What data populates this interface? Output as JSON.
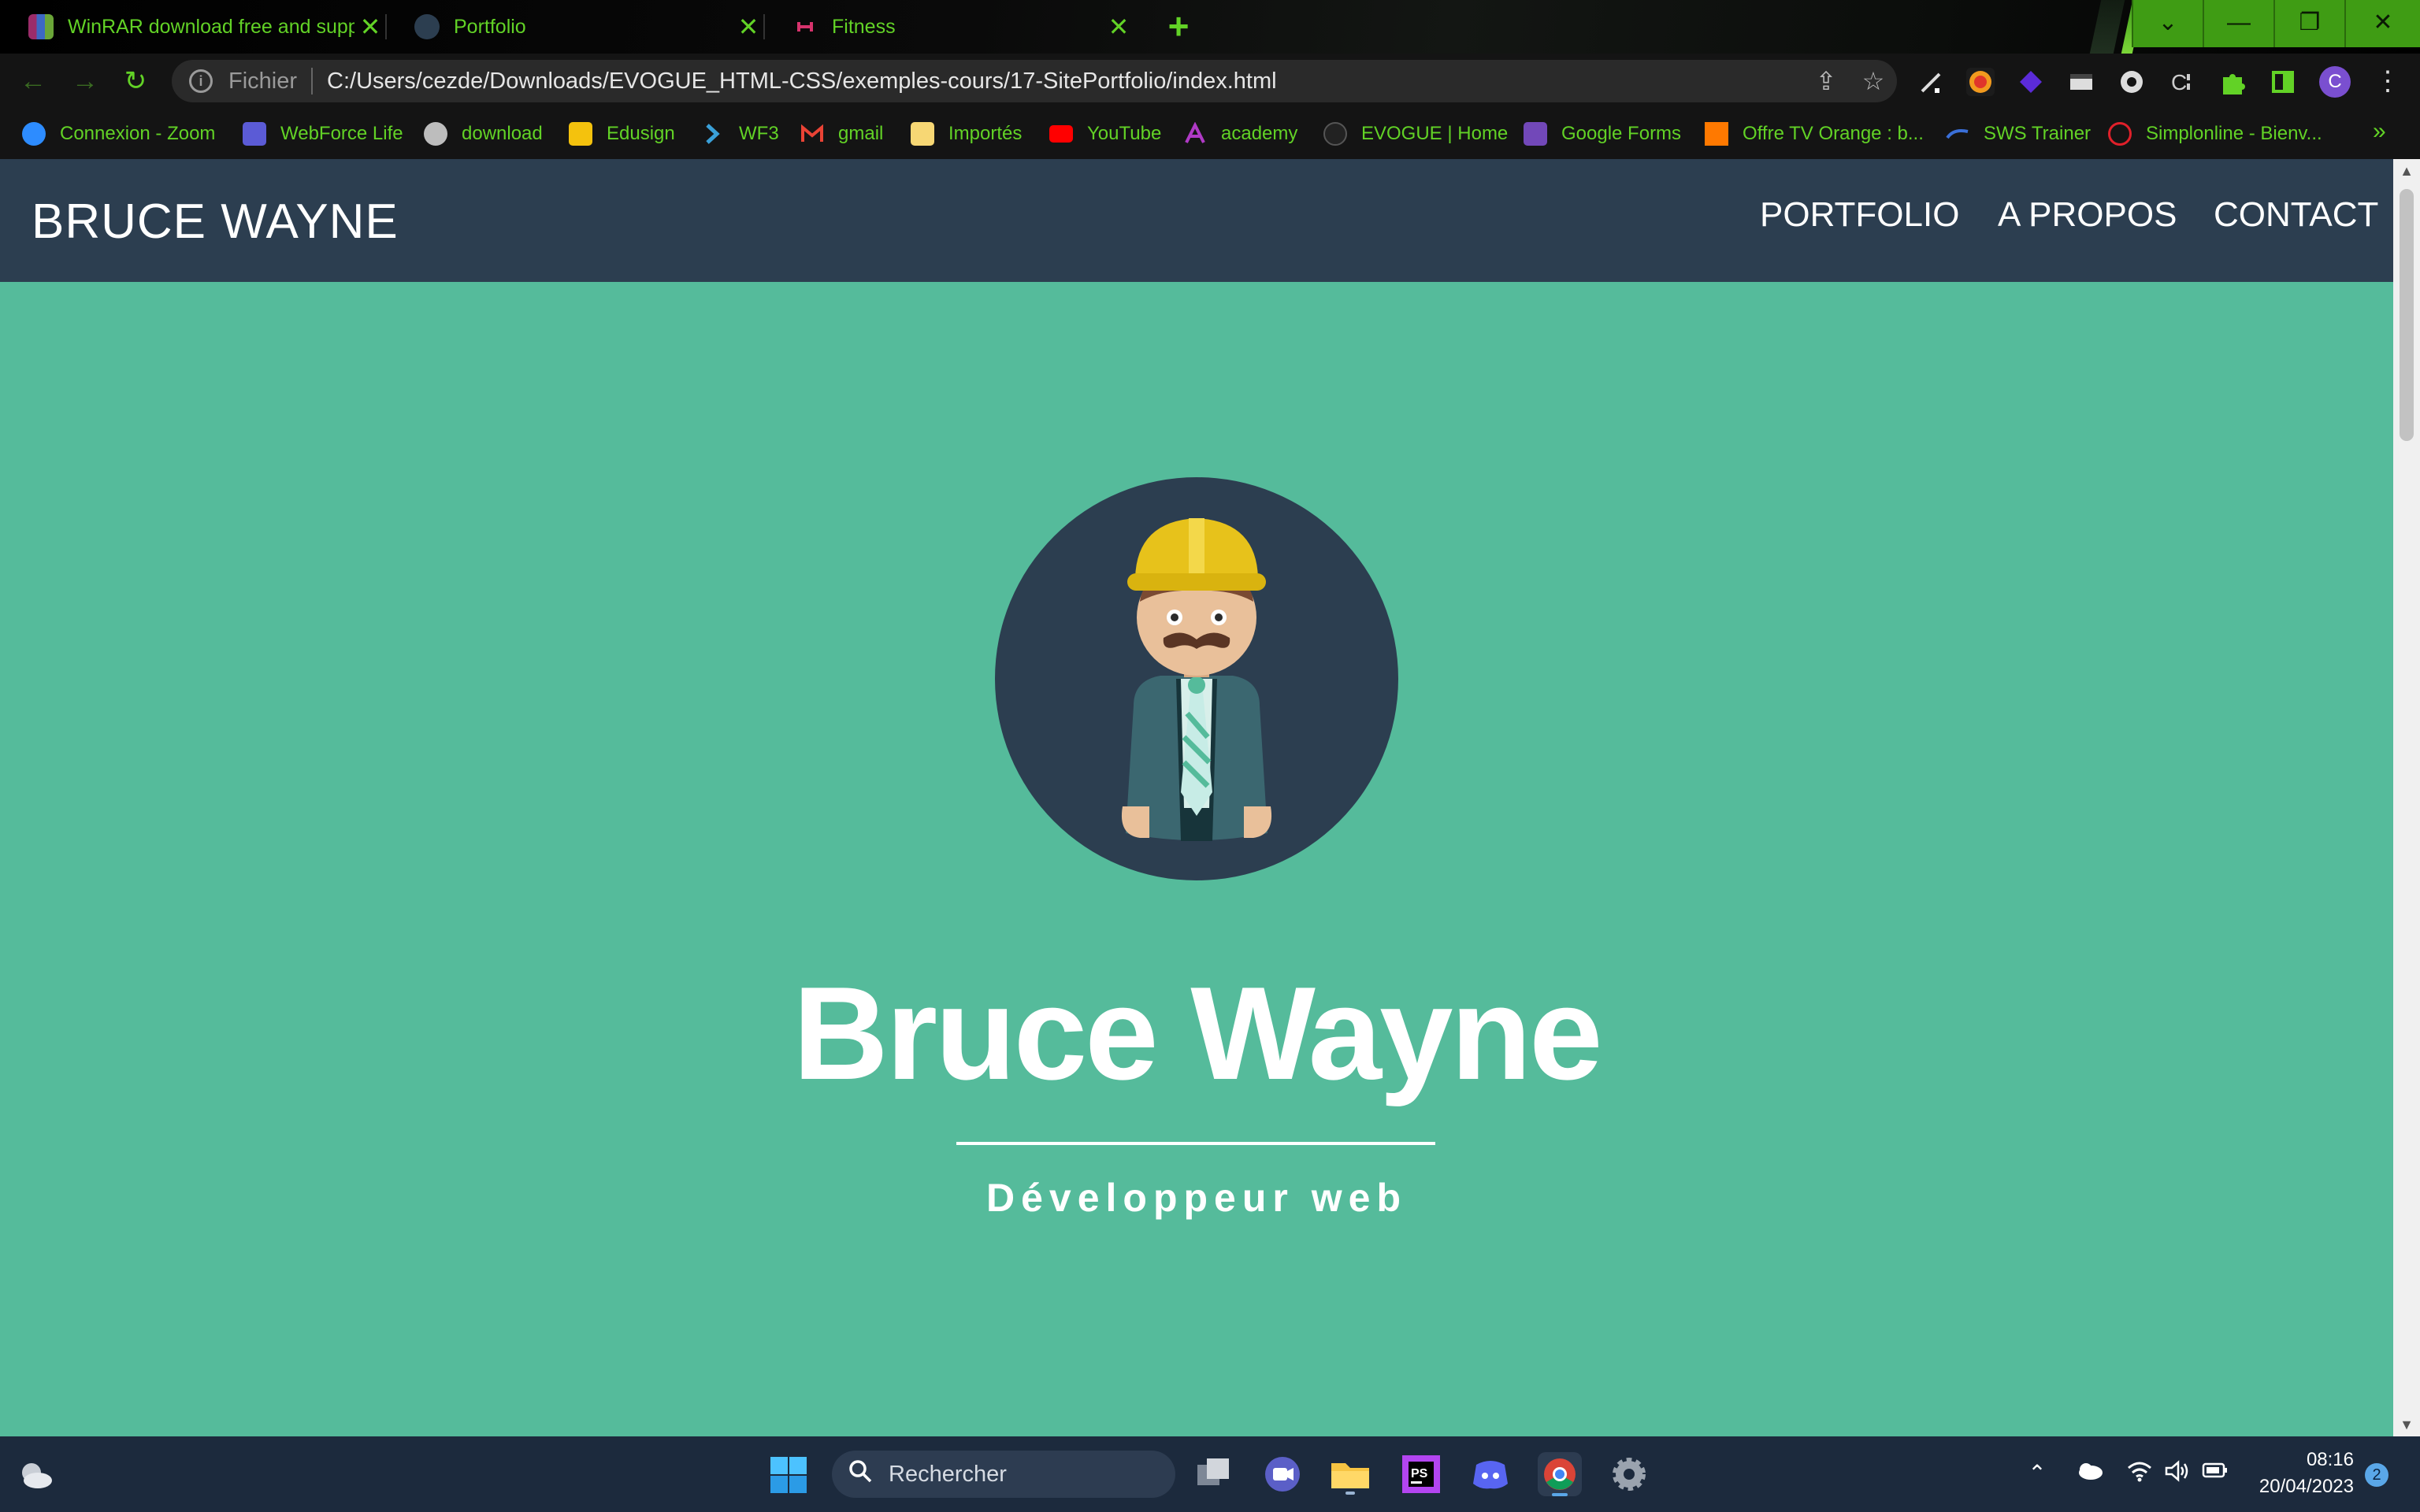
{
  "browser": {
    "tabs": [
      {
        "title": "WinRAR download free and supp",
        "close": "✕"
      },
      {
        "title": "Portfolio",
        "close": "✕"
      },
      {
        "title": "Fitness",
        "close": "✕"
      }
    ],
    "new_tab": "+",
    "window_controls": {
      "dropdown": "⌄",
      "minimize": "—",
      "restore": "❐",
      "close": "✕"
    },
    "nav": {
      "back": "←",
      "forward": "→",
      "reload": "↻"
    },
    "address": {
      "info": "i",
      "scheme": "Fichier",
      "url": "C:/Users/cezde/Downloads/EVOGUE_HTML-CSS/exemples-cours/17-SitePortfolio/index.html",
      "share": "⇪",
      "star": "☆"
    },
    "profile_initial": "C",
    "menu": "⋮",
    "bookmarks": [
      {
        "label": "Connexion - Zoom",
        "color": "#2d8cff"
      },
      {
        "label": "WebForce Life",
        "color": "#5b5bd6"
      },
      {
        "label": "download",
        "color": "#c8c8c8"
      },
      {
        "label": "Edusign",
        "color": "#f4c20d"
      },
      {
        "label": "WF3",
        "color": "#3aa0d8"
      },
      {
        "label": "gmail",
        "color": "#ea4335"
      },
      {
        "label": "Importés",
        "color": "#f7d774"
      },
      {
        "label": "YouTube",
        "color": "#ff0000"
      },
      {
        "label": "academy",
        "color": "#b03ac6"
      },
      {
        "label": "EVOGUE | Home",
        "color": "#444444"
      },
      {
        "label": "Google Forms",
        "color": "#7248b9"
      },
      {
        "label": "Offre TV Orange : b...",
        "color": "#ff7900"
      },
      {
        "label": "SWS Trainer",
        "color": "#3a6fd8"
      },
      {
        "label": "Simplonline - Bienv...",
        "color": "#e0202a"
      }
    ],
    "bookmarks_more": "»"
  },
  "site": {
    "brand": "BRUCE WAYNE",
    "nav": [
      "PORTFOLIO",
      "A PROPOS",
      "CONTACT"
    ],
    "hero_name": "Bruce Wayne",
    "hero_subtitle": "Développeur web",
    "colors": {
      "header": "#2c3e50",
      "background": "#55bb9b",
      "text": "#ffffff"
    }
  },
  "taskbar": {
    "search_placeholder": "Rechercher",
    "time": "08:16",
    "date": "20/04/2023",
    "notifications": "2",
    "apps": [
      "start-icon",
      "task-view-icon",
      "teams-icon",
      "file-explorer-icon",
      "phpstorm-icon",
      "discord-icon",
      "chrome-icon",
      "settings-icon"
    ]
  }
}
